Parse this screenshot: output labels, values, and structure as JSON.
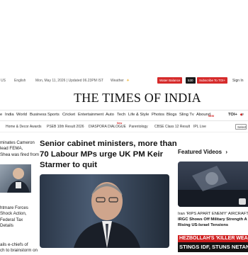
{
  "topbar": {
    "region": "US",
    "language": "English",
    "dateline": "Mon, May 11, 2026 | Updated 06.23PM IST",
    "weather_label": "Weather",
    "water_balance_label": "Water Balance",
    "water_balance_value": "530",
    "subscribe_label": "Subscribe To TOI+",
    "signin_label": "Sign In"
  },
  "masthead": {
    "title": "THE TIMES OF INDIA"
  },
  "nav": {
    "items": [
      "e",
      "India",
      "World",
      "Business",
      "Sports",
      "Cricket",
      "Entertainment",
      "Auto",
      "Tech",
      "Life & Style",
      "Photos",
      "Blogs",
      "Sling Tv",
      "Abound"
    ],
    "new_badge": "NEW",
    "toi_plus": "TOI+"
  },
  "subnav": {
    "items": [
      "Home & Decor Awards",
      "PSEB 10th Result 2026",
      "DIASPORA DIALOGUE",
      "Parentology",
      "CBSE Class 12 Result",
      "IPL Live"
    ],
    "new_badge": "New",
    "select_label": "Select"
  },
  "left_column": {
    "story1_lines": [
      "minates Cameron",
      "lead FEMA,",
      "Shea was fired from"
    ],
    "story2_lines": [
      "htmare Forces",
      "Shock Action,",
      "Federal Tax",
      "Details"
    ],
    "story3_lines": [
      "ails e-chiefs of",
      "ch to brainstorm on"
    ]
  },
  "main_story": {
    "headline_lines": [
      "Senior cabinet ministers, more than",
      "70 Labour MPs urge UK PM Keir",
      "Starmer to quit"
    ]
  },
  "featured_videos": {
    "title": "Featured Videos",
    "chevron": "›",
    "caption_lines": [
      "Iran 'RIPS APART ENEMY' AIRCRAFT",
      "IRGC Shows Off Military Strength A",
      "Rising US-Israel Tensions"
    ],
    "ticker_red": "HEZBOLLAH'S 'KILLER WEA",
    "ticker_dark": "STINGS IDF, STUNS NETAN"
  },
  "colors": {
    "accent_red": "#d62b2b",
    "text_dark": "#111111",
    "ticker_dark": "#141414"
  }
}
